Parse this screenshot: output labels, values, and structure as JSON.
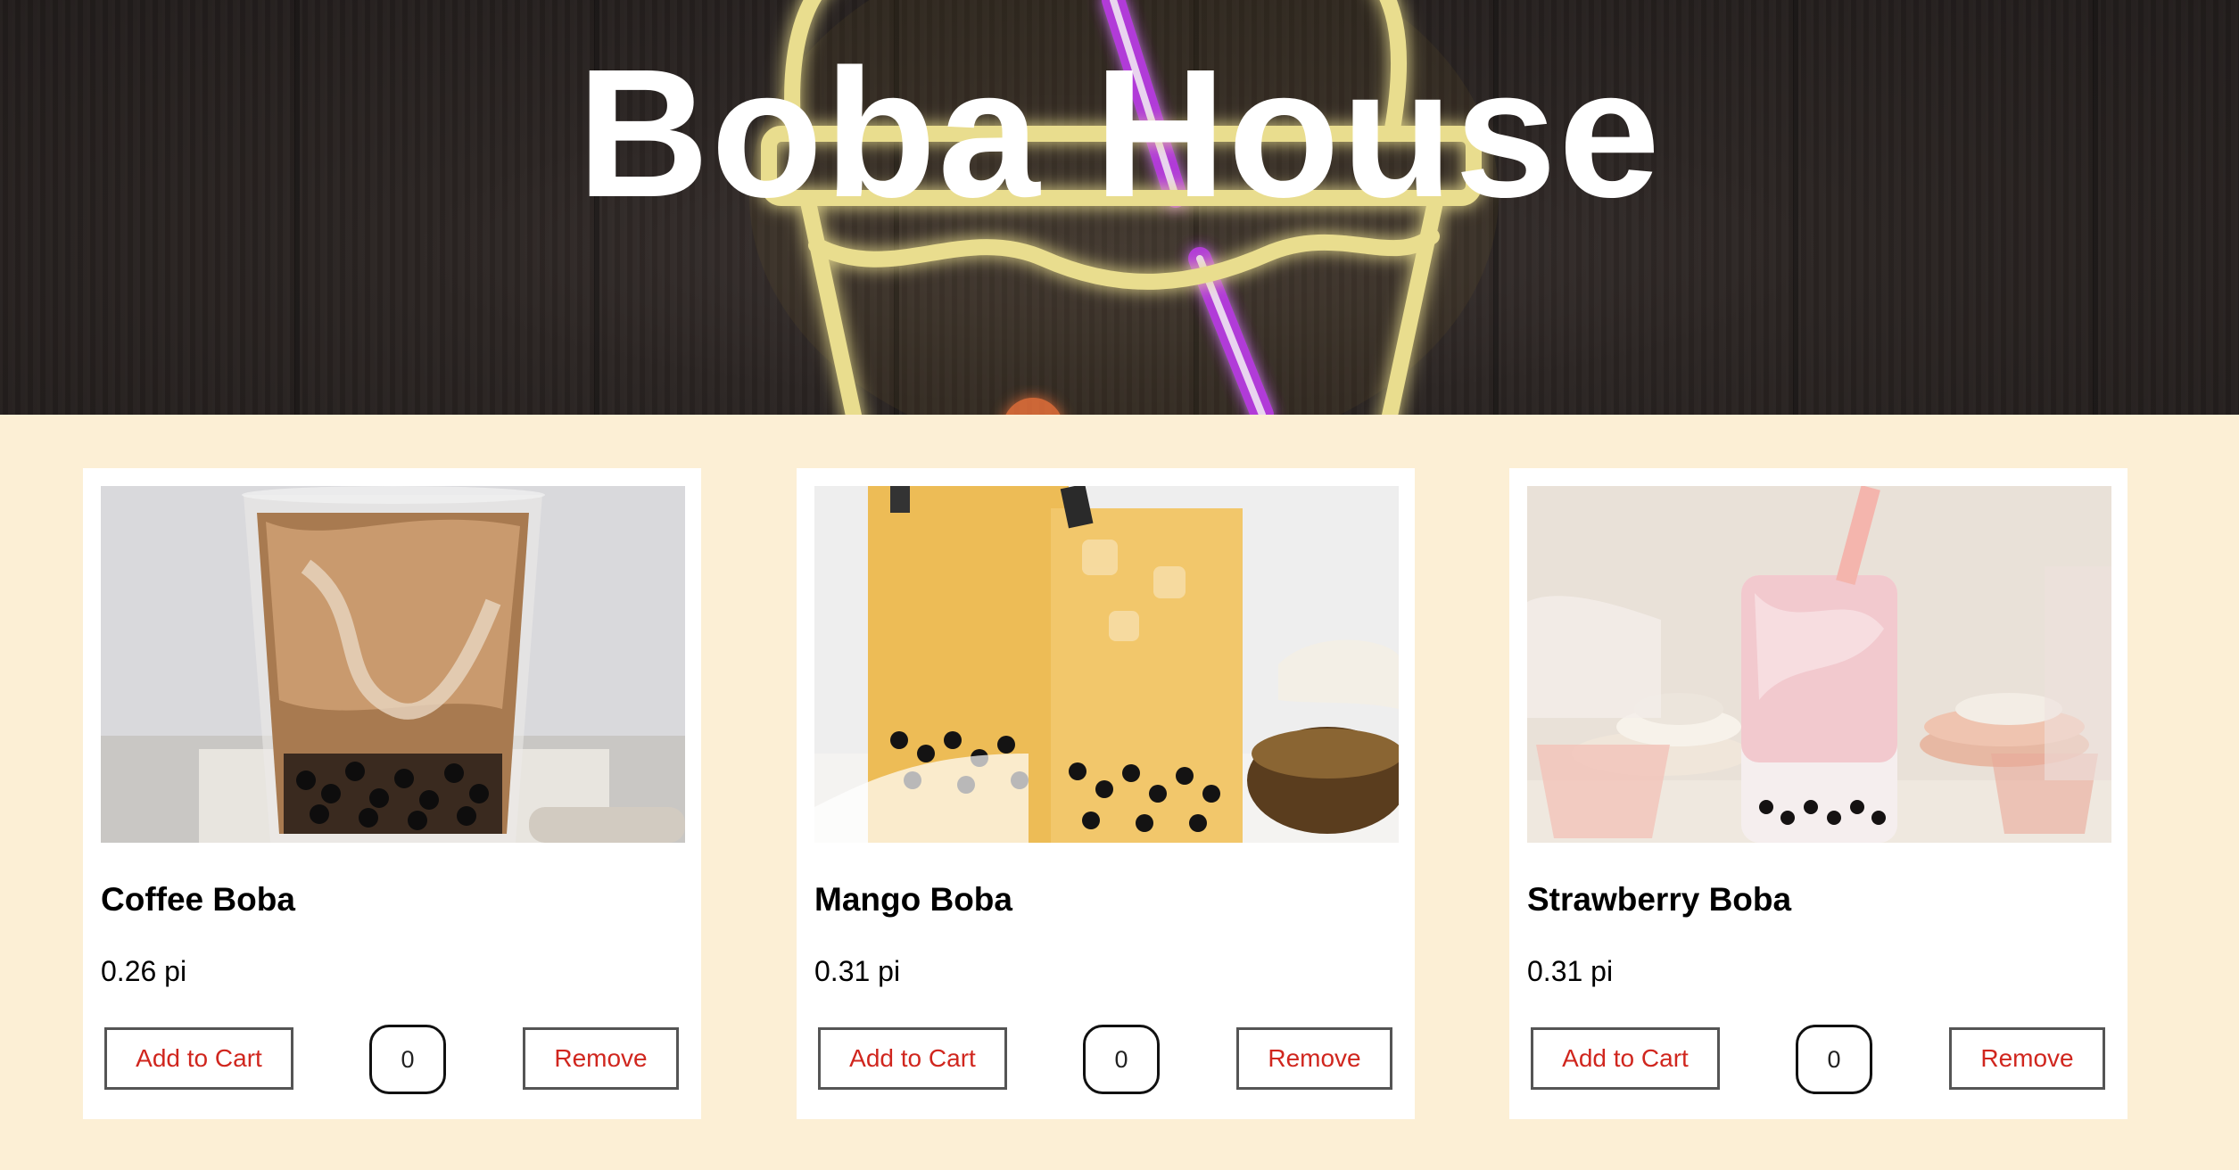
{
  "header": {
    "title": "Boba House"
  },
  "colors": {
    "page_background": "#fcefd5",
    "button_text": "#d0261e",
    "neon_yellow": "#f3e04b",
    "neon_purple": "#b13ad8"
  },
  "products": [
    {
      "name": "Coffee Boba",
      "price": "0.26 pi",
      "add_label": "Add to Cart",
      "quantity": "0",
      "remove_label": "Remove",
      "image_icon": "coffee-boba-photo"
    },
    {
      "name": "Mango Boba",
      "price": "0.31 pi",
      "add_label": "Add to Cart",
      "quantity": "0",
      "remove_label": "Remove",
      "image_icon": "mango-boba-photo"
    },
    {
      "name": "Strawberry Boba",
      "price": "0.31 pi",
      "add_label": "Add to Cart",
      "quantity": "0",
      "remove_label": "Remove",
      "image_icon": "strawberry-boba-photo"
    }
  ]
}
